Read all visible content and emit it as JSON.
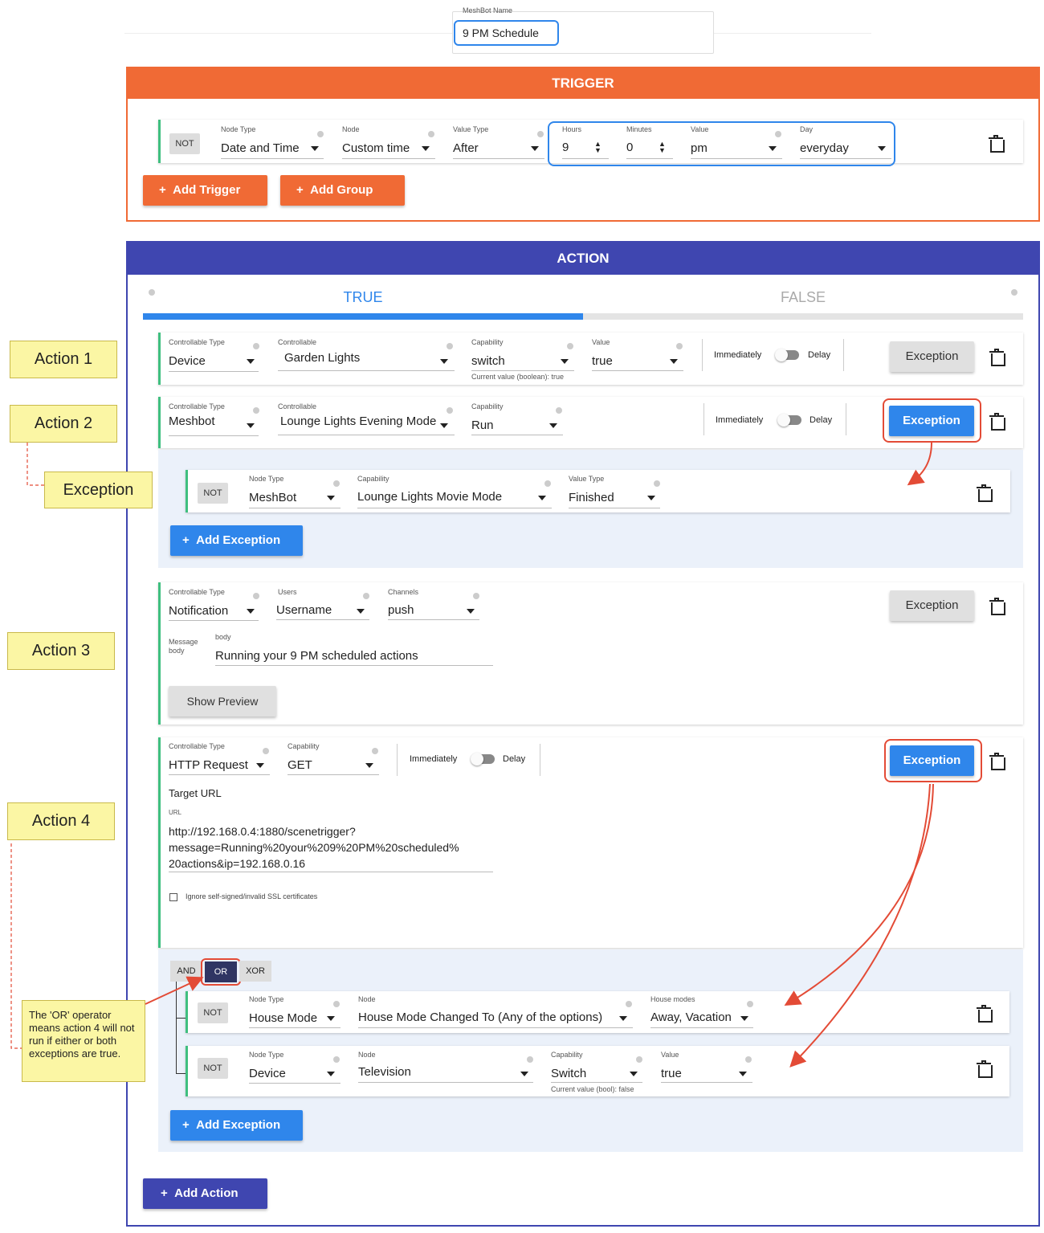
{
  "meshbot": {
    "label": "MeshBot Name",
    "value": "9 PM Schedule"
  },
  "trigger": {
    "header": "TRIGGER",
    "row": {
      "not": "NOT",
      "node_type": {
        "label": "Node Type",
        "value": "Date and Time"
      },
      "node": {
        "label": "Node",
        "value": "Custom time"
      },
      "value_type": {
        "label": "Value Type",
        "value": "After"
      },
      "hours": {
        "label": "Hours",
        "value": "9"
      },
      "minutes": {
        "label": "Minutes",
        "value": "0"
      },
      "value": {
        "label": "Value",
        "value": "pm"
      },
      "day": {
        "label": "Day",
        "value": "everyday"
      }
    },
    "add_trigger": "Add Trigger",
    "add_group": "Add Group"
  },
  "action": {
    "header": "ACTION",
    "tab_true": "TRUE",
    "tab_false": "FALSE",
    "a1": {
      "ct_label": "Controllable Type",
      "ct_value": "Device",
      "c_label": "Controllable",
      "c_value": "Garden Lights",
      "cap_label": "Capability",
      "cap_value": "switch",
      "cap_note": "Current value (boolean): true",
      "val_label": "Value",
      "val_value": "true",
      "immediately": "Immediately",
      "delay": "Delay",
      "exception": "Exception"
    },
    "a2": {
      "ct_label": "Controllable Type",
      "ct_value": "Meshbot",
      "c_label": "Controllable",
      "c_value": "Lounge Lights Evening Mode",
      "cap_label": "Capability",
      "cap_value": "Run",
      "immediately": "Immediately",
      "delay": "Delay",
      "exception": "Exception",
      "exc_row": {
        "not": "NOT",
        "nt_label": "Node Type",
        "nt_value": "MeshBot",
        "cap_label": "Capability",
        "cap_value": "Lounge Lights Movie Mode",
        "vt_label": "Value Type",
        "vt_value": "Finished"
      },
      "add_exception": "Add Exception"
    },
    "a3": {
      "ct_label": "Controllable Type",
      "ct_value": "Notification",
      "users_label": "Users",
      "users_value": "Username",
      "ch_label": "Channels",
      "ch_value": "push",
      "mb_label": "Message body",
      "body_label": "body",
      "body_value": "Running your 9 PM scheduled actions",
      "show_preview": "Show Preview",
      "exception": "Exception"
    },
    "a4": {
      "ct_label": "Controllable Type",
      "ct_value": "HTTP Request",
      "cap_label": "Capability",
      "cap_value": "GET",
      "immediately": "Immediately",
      "delay": "Delay",
      "exception": "Exception",
      "target_url": "Target URL",
      "url_label": "URL",
      "url_line1": "http://192.168.0.4:1880/scenetrigger?",
      "url_line2": "message=Running%20your%209%20PM%20scheduled%",
      "url_line3": "20actions&ip=192.168.0.16",
      "ssl": "Ignore self-signed/invalid SSL certificates",
      "ops": [
        "AND",
        "OR",
        "XOR"
      ],
      "exc1": {
        "not": "NOT",
        "nt_label": "Node Type",
        "nt_value": "House Mode",
        "node_label": "Node",
        "node_value": "House Mode Changed To (Any of the options)",
        "hm_label": "House modes",
        "hm_value": "Away, Vacation"
      },
      "exc2": {
        "not": "NOT",
        "nt_label": "Node Type",
        "nt_value": "Device",
        "node_label": "Node",
        "node_value": "Television",
        "cap_label": "Capability",
        "cap_value": "Switch",
        "cap_note": "Current value (bool): false",
        "val_label": "Value",
        "val_value": "true"
      },
      "add_exception": "Add Exception"
    },
    "add_action": "Add Action"
  },
  "notes": {
    "action1": "Action 1",
    "action2": "Action 2",
    "exception": "Exception",
    "action3": "Action 3",
    "action4": "Action 4",
    "or_note": "The 'OR' operator means action 4 will not run if either or both exceptions are true."
  },
  "colors": {
    "orange": "#f06a35",
    "navy": "#3f46b0",
    "blue": "#2f86eb",
    "green": "#3fbf7f",
    "annot_red": "#e34b36"
  }
}
